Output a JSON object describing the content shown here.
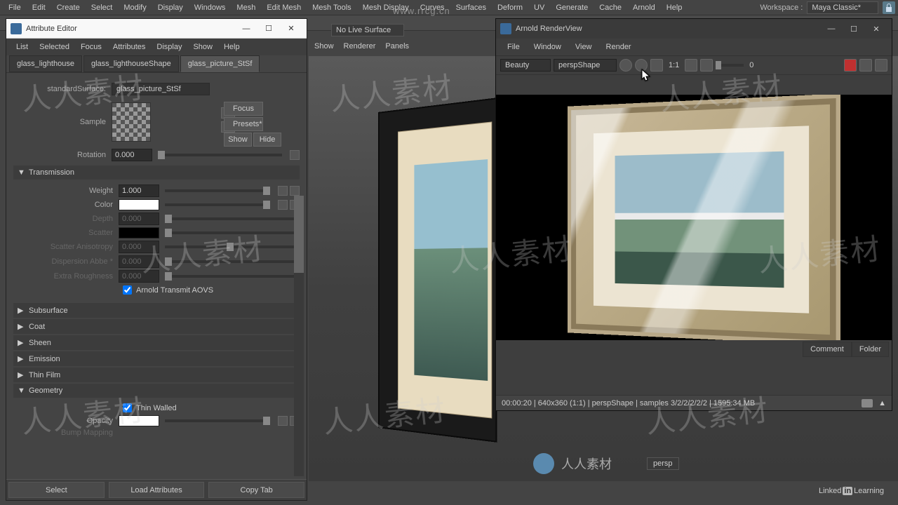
{
  "mainMenu": [
    "File",
    "Edit",
    "Create",
    "Select",
    "Modify",
    "Display",
    "Windows",
    "Mesh",
    "Edit Mesh",
    "Mesh Tools",
    "Mesh Display",
    "Curves",
    "Surfaces",
    "Deform",
    "UV",
    "Generate",
    "Cache",
    "Arnold",
    "Help"
  ],
  "workspace": {
    "label": "Workspace :",
    "value": "Maya Classic*"
  },
  "watermarkUrl": "www.rrcg.cn",
  "noLiveSurface": "No Live Surface",
  "viewportMenu": [
    "Show",
    "Renderer",
    "Panels"
  ],
  "persp": {
    "chinese": "人人素材",
    "label": "persp"
  },
  "linkedin": {
    "prefix": "Linked",
    "in": "in",
    "suffix": "Learning"
  },
  "attrEditor": {
    "title": "Attribute Editor",
    "menu": [
      "List",
      "Selected",
      "Focus",
      "Attributes",
      "Display",
      "Show",
      "Help"
    ],
    "tabs": [
      "glass_lighthouse",
      "glass_lighthouseShape",
      "glass_picture_StSf"
    ],
    "activeTab": 2,
    "surfaceLabel": "standardSurface:",
    "surfaceValue": "glass_picture_StSf",
    "sideButtons": {
      "focus": "Focus",
      "presets": "Presets*",
      "show": "Show",
      "hide": "Hide"
    },
    "sampleLabel": "Sample",
    "rotation": {
      "label": "Rotation",
      "value": "0.000"
    },
    "transmission": {
      "title": "Transmission",
      "weight": {
        "label": "Weight",
        "value": "1.000"
      },
      "color": {
        "label": "Color"
      },
      "depth": {
        "label": "Depth",
        "value": "0.000"
      },
      "scatter": {
        "label": "Scatter"
      },
      "scatterAniso": {
        "label": "Scatter Anisotropy",
        "value": "0.000"
      },
      "dispersion": {
        "label": "Dispersion Abbe *",
        "value": "0.000"
      },
      "extraRough": {
        "label": "Extra Roughness",
        "value": "0.000"
      },
      "aovs": "Arnold Transmit AOVS"
    },
    "collapsed": [
      "Subsurface",
      "Coat",
      "Sheen",
      "Emission",
      "Thin Film"
    ],
    "geometry": {
      "title": "Geometry",
      "thinWalled": "Thin Walled",
      "opacity": {
        "label": "Opacity"
      },
      "bump": {
        "label": "Bump Mapping"
      }
    },
    "footer": [
      "Select",
      "Load Attributes",
      "Copy Tab"
    ]
  },
  "renderView": {
    "title": "Arnold RenderView",
    "menu": [
      "File",
      "Window",
      "View",
      "Render"
    ],
    "toolbar": {
      "aov": "Beauty",
      "camera": "perspShape",
      "scale": "1:1",
      "exposure": "0"
    },
    "tabs": [
      "Comment",
      "Folder"
    ],
    "status": "00:00:20  |  640x360 (1:1)  |  perspShape  |  samples 3/2/2/2/2/2  |  1595.34 MB"
  },
  "watermarkText": "人人素材"
}
